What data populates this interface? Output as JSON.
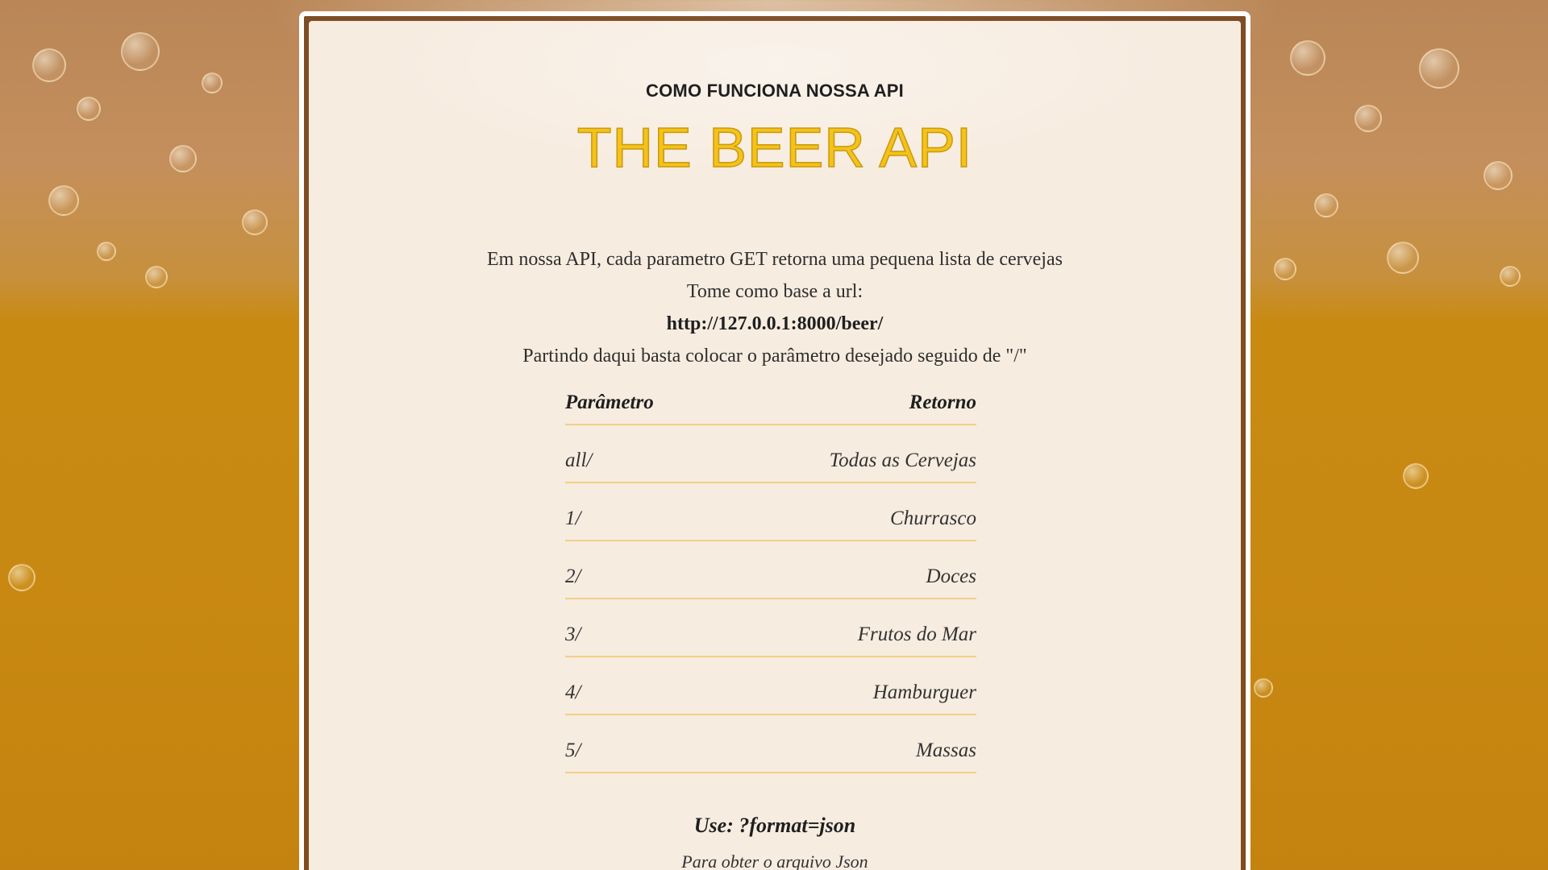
{
  "header": {
    "subtitle": "COMO FUNCIONA NOSSA API",
    "title": "THE BEER API"
  },
  "intro": {
    "line1": "Em nossa API, cada parametro GET retorna uma pequena lista de cervejas",
    "line2": "Tome como base a url:",
    "base_url": "http://127.0.0.1:8000/beer/",
    "line4": "Partindo daqui basta colocar o parâmetro desejado seguido de \"/\""
  },
  "table": {
    "columns": [
      "Parâmetro",
      "Retorno"
    ],
    "rows": [
      {
        "param": "all/",
        "result": "Todas as Cervejas"
      },
      {
        "param": "1/",
        "result": "Churrasco"
      },
      {
        "param": "2/",
        "result": "Doces"
      },
      {
        "param": "3/",
        "result": "Frutos do Mar"
      },
      {
        "param": "4/",
        "result": "Hamburguer"
      },
      {
        "param": "5/",
        "result": "Massas"
      }
    ]
  },
  "footer": {
    "use_label": "Use: ?format=json",
    "use_note": "Para obter o arquivo Json"
  },
  "colors": {
    "title": "#f4c21a",
    "panel_background": "#f7ece0",
    "table_rule": "#f1cf86",
    "beer_background": "#c88912"
  }
}
